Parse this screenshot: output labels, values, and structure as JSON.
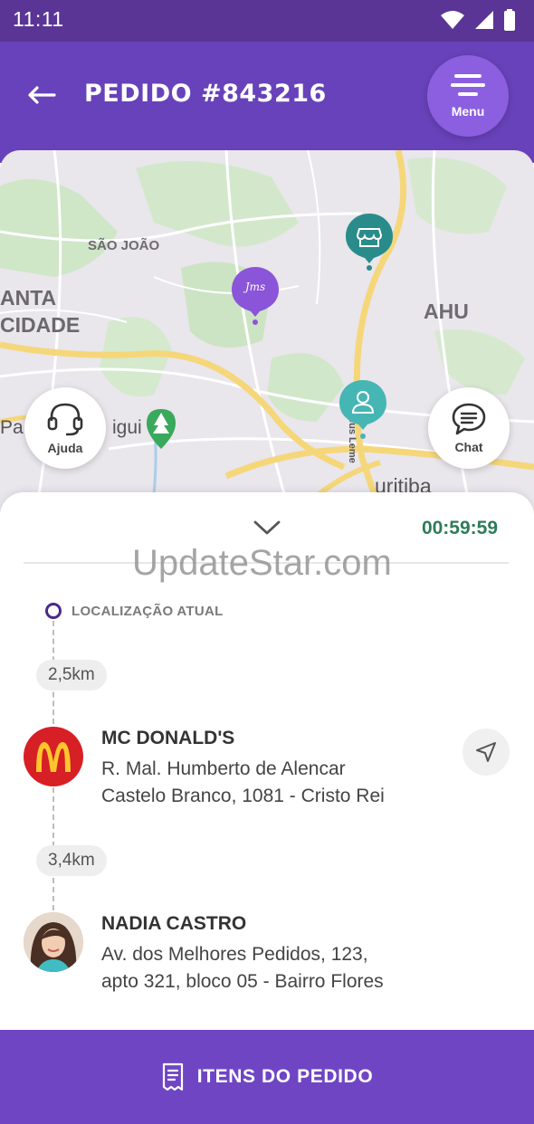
{
  "status_bar": {
    "time": "11:11"
  },
  "header": {
    "title": "PEDIDO #843216",
    "menu_label": "Menu"
  },
  "map": {
    "labels": {
      "sao_joao": "SÃO JOÃO",
      "anta": "ANTA",
      "cidade": "CIDADE",
      "ahu": "AHU",
      "pa": "Pa",
      "igui": "igui",
      "uritiba": "uritiba",
      "street": "R. Mateus Leme"
    },
    "help_label": "Ajuda",
    "chat_label": "Chat",
    "driver_pin_text": "Jms"
  },
  "sheet": {
    "timer": "00:59:59",
    "watermark": "UpdateStar.com",
    "current_location_label": "LOCALIZAÇÃO ATUAL",
    "stops": [
      {
        "distance": "2,5km",
        "name": "MC DONALD'S",
        "address_line1": "R. Mal. Humberto de Alencar",
        "address_line2": "Castelo Branco, 1081 - Cristo Rei"
      },
      {
        "distance": "3,4km",
        "name": "NADIA CASTRO",
        "address_line1": "Av. dos Melhores Pedidos, 123,",
        "address_line2": "apto 321, bloco 05 - Bairro Flores"
      }
    ]
  },
  "footer": {
    "label": "ITENS DO PEDIDO"
  },
  "colors": {
    "header": "#6842ba",
    "status_bar": "#5a3596",
    "timer": "#2f7b5a",
    "store_pin": "#2a8c8a",
    "customer_pin": "#46b6b4",
    "footer": "#6f45c4",
    "mcdonalds_red": "#d71f26"
  }
}
